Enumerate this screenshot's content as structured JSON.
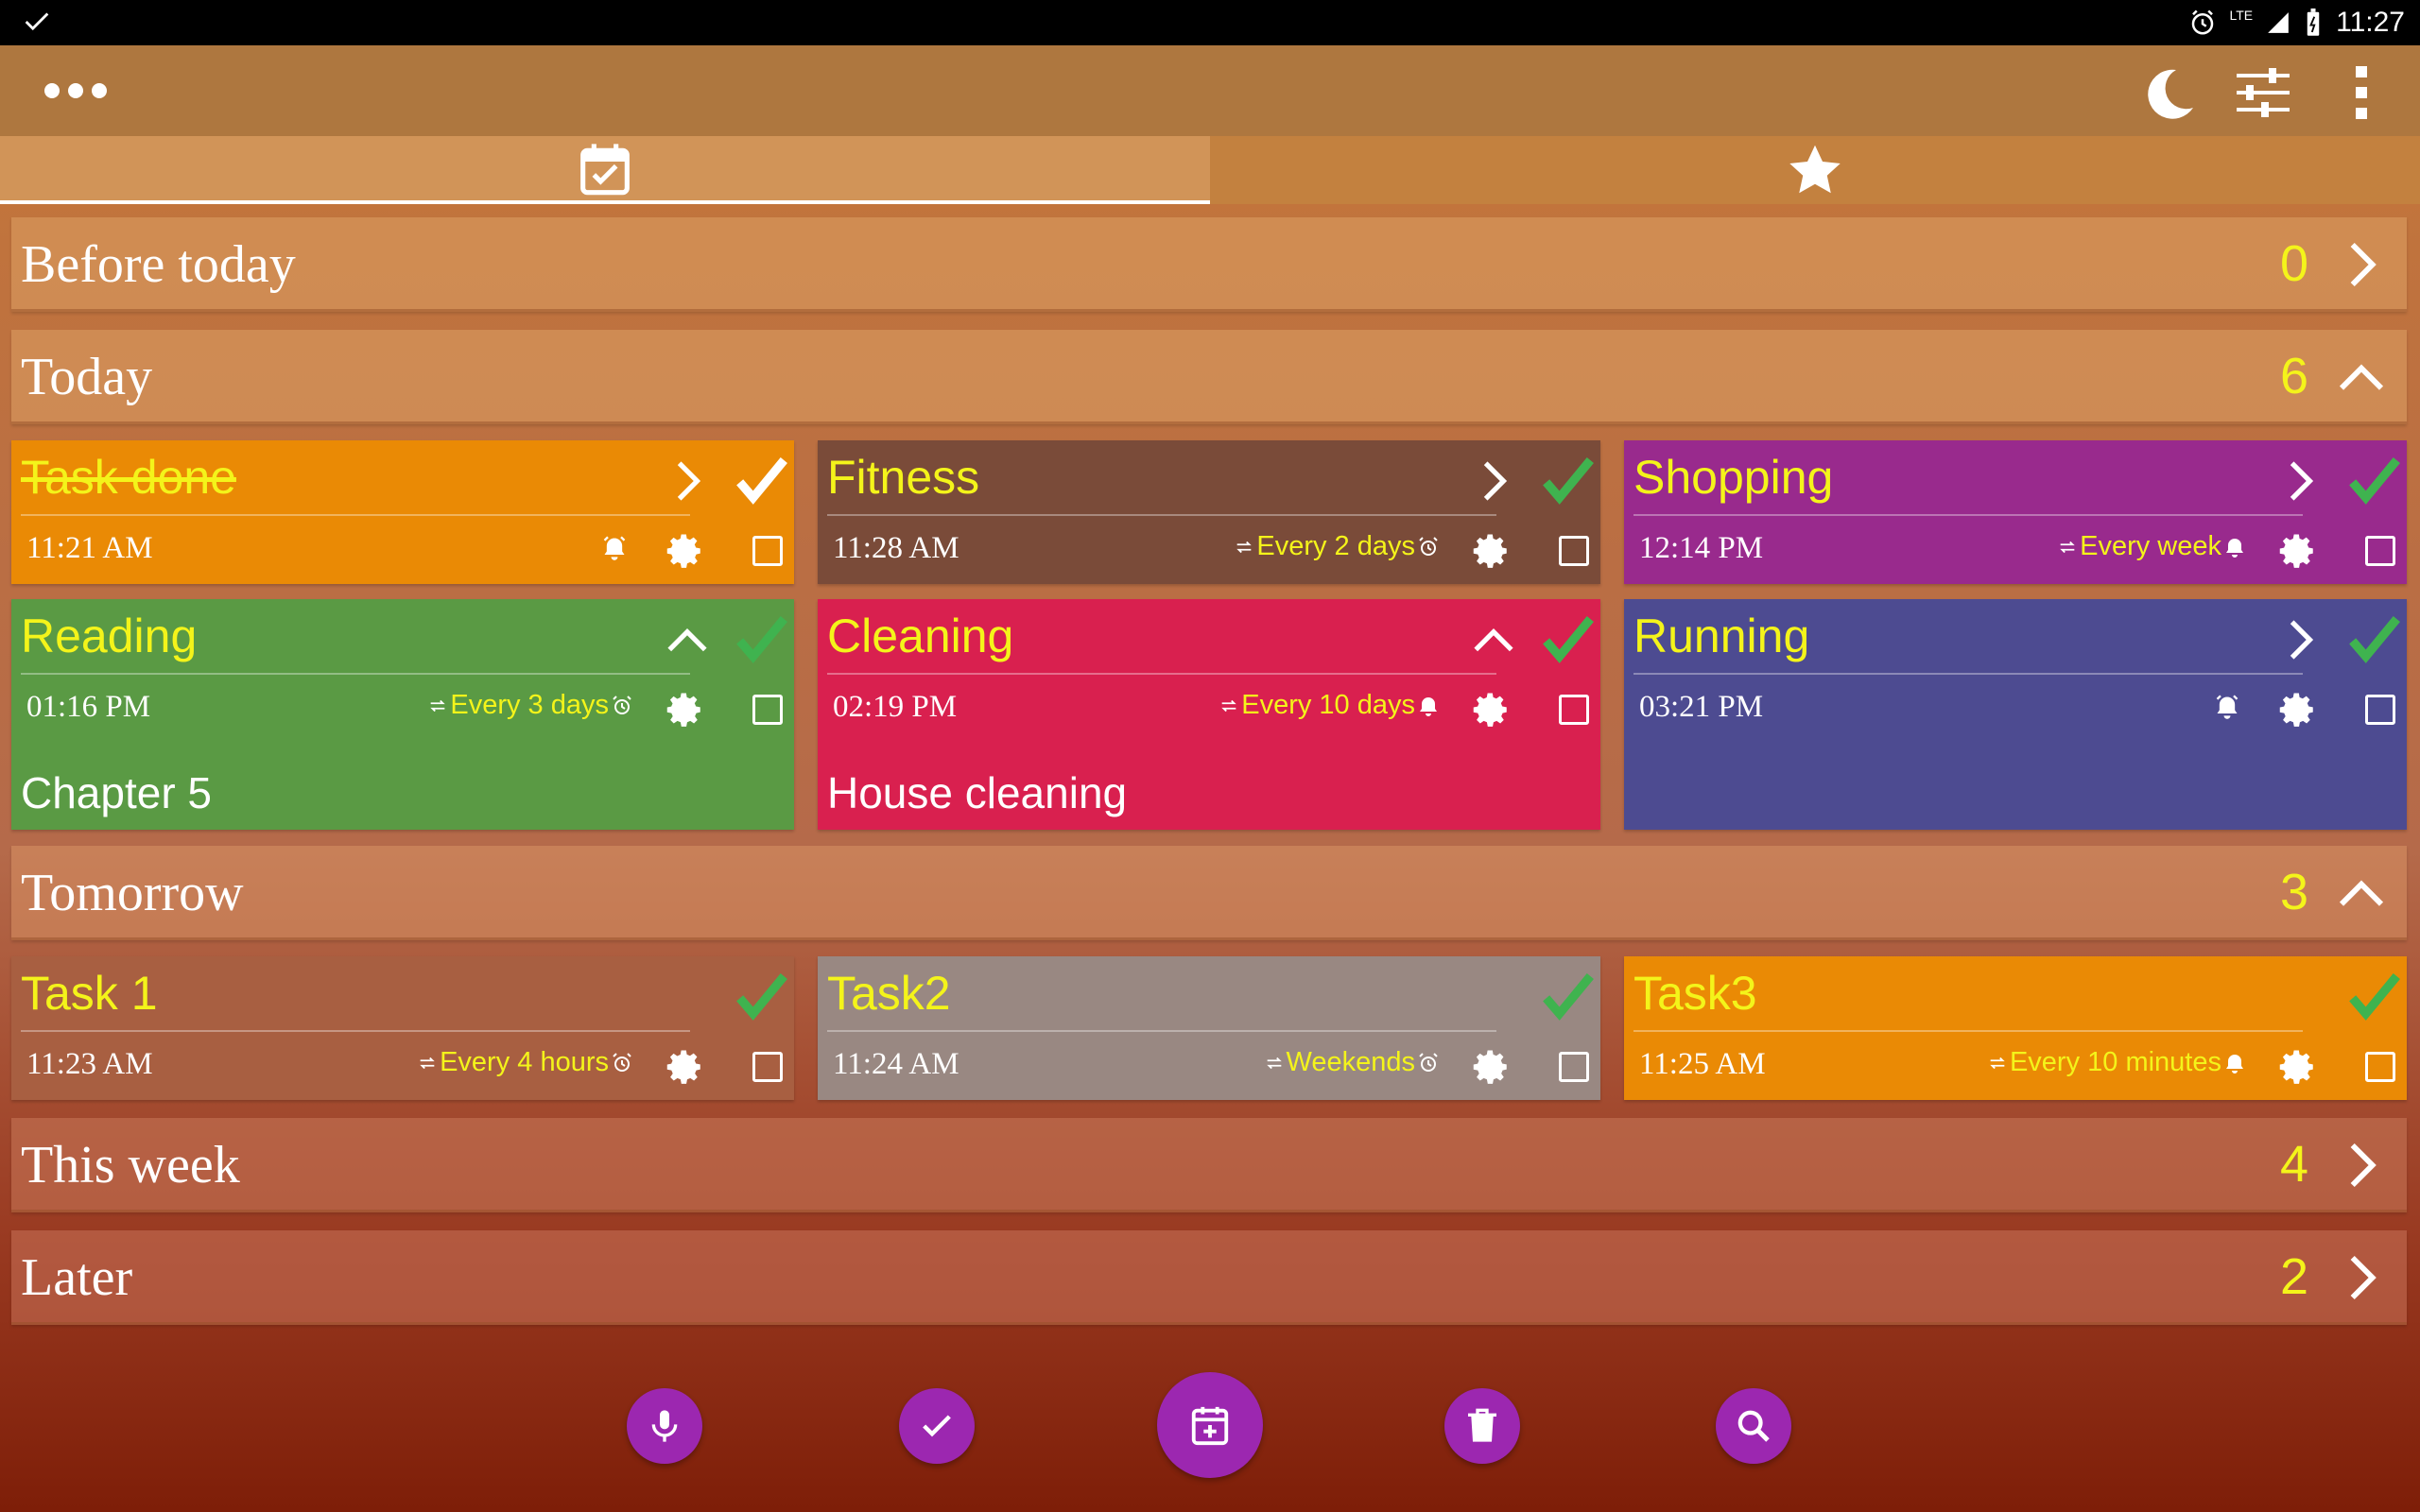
{
  "status_bar": {
    "time": "11:27",
    "network": "LTE"
  },
  "app_bar": {
    "icons": [
      "more-horiz-icon",
      "night-mode-icon",
      "filter-sliders-icon",
      "overflow-menu-icon"
    ]
  },
  "tabs": [
    {
      "icon": "calendar-check-icon",
      "active": true
    },
    {
      "icon": "star-icon",
      "active": false
    }
  ],
  "sections": [
    {
      "title": "Before today",
      "count": "0",
      "expanded": false
    },
    {
      "title": "Today",
      "count": "6",
      "expanded": true
    },
    {
      "title": "Tomorrow",
      "count": "3",
      "expanded": true
    },
    {
      "title": "This week",
      "count": "4",
      "expanded": false
    },
    {
      "title": "Later",
      "count": "2",
      "expanded": false
    }
  ],
  "today_tasks": [
    {
      "title": "Task done",
      "time": "11:21 AM",
      "repeat": "",
      "note": "",
      "color": "#ea8a05",
      "done": true,
      "alarm": true
    },
    {
      "title": "Fitness",
      "time": "11:28 AM",
      "repeat": "Every 2 days",
      "note": "",
      "color": "#7a4b39",
      "done": false,
      "alarm": true
    },
    {
      "title": "Shopping",
      "time": "12:14 PM",
      "repeat": "Every week",
      "note": "",
      "color": "#992a8d",
      "done": false,
      "alarm": true
    },
    {
      "title": "Reading",
      "time": "01:16 PM",
      "repeat": "Every 3 days",
      "note": "Chapter 5",
      "color": "#5a9a44",
      "done": false,
      "alarm": true
    },
    {
      "title": "Cleaning",
      "time": "02:19 PM",
      "repeat": "Every 10 days",
      "note": "House cleaning",
      "color": "#d9204f",
      "done": false,
      "alarm": true
    },
    {
      "title": "Running",
      "time": "03:21 PM",
      "repeat": "",
      "note": "",
      "color": "#4d4b91",
      "done": false,
      "alarm": true
    }
  ],
  "tomorrow_tasks": [
    {
      "title": "Task 1",
      "time": "11:23 AM",
      "repeat": "Every 4 hours",
      "color": "#a85f41"
    },
    {
      "title": "Task2",
      "time": "11:24 AM",
      "repeat": "Weekends",
      "color": "#998882"
    },
    {
      "title": "Task3",
      "time": "11:25 AM",
      "repeat": "Every 10 minutes",
      "color": "#ea8a05"
    }
  ],
  "fabs": [
    "microphone-icon",
    "check-icon",
    "add-event-icon",
    "trash-icon",
    "search-icon"
  ],
  "colors": {
    "accent_yellow": "#f4f41a",
    "fab_purple": "#9c27b0",
    "check_green": "#3fb34f"
  }
}
